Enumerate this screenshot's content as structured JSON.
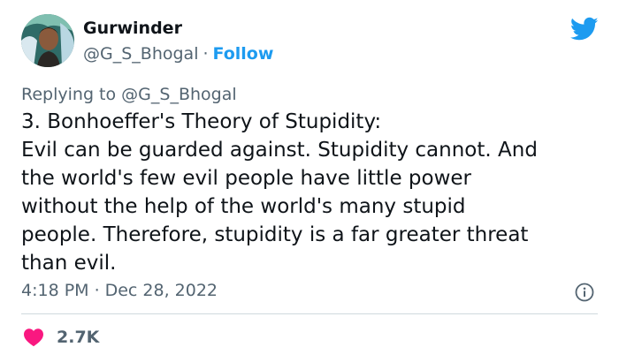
{
  "author": {
    "display_name": "Gurwinder",
    "handle": "@G_S_Bhogal",
    "separator": "·",
    "follow_label": "Follow"
  },
  "reply": {
    "prefix": "Replying to",
    "handle": "@G_S_Bhogal"
  },
  "tweet": {
    "lines": [
      "3. Bonhoeffer's Theory of Stupidity:",
      "Evil can be guarded against. Stupidity cannot. And",
      "the world's few evil people have little power",
      "without the help of the world's many stupid",
      "people. Therefore, stupidity is a far greater threat",
      "than evil."
    ]
  },
  "meta": {
    "time": "4:18 PM",
    "separator": "·",
    "date": "Dec 28, 2022"
  },
  "likes": {
    "count": "2.7K"
  },
  "colors": {
    "accent": "#1d9bf0",
    "heart": "#f91880",
    "text": "#0f1419",
    "muted": "#536471",
    "divider": "#cfd9de"
  },
  "icons": {
    "brand": "twitter-bird-icon",
    "info": "info-icon",
    "like": "heart-icon"
  }
}
